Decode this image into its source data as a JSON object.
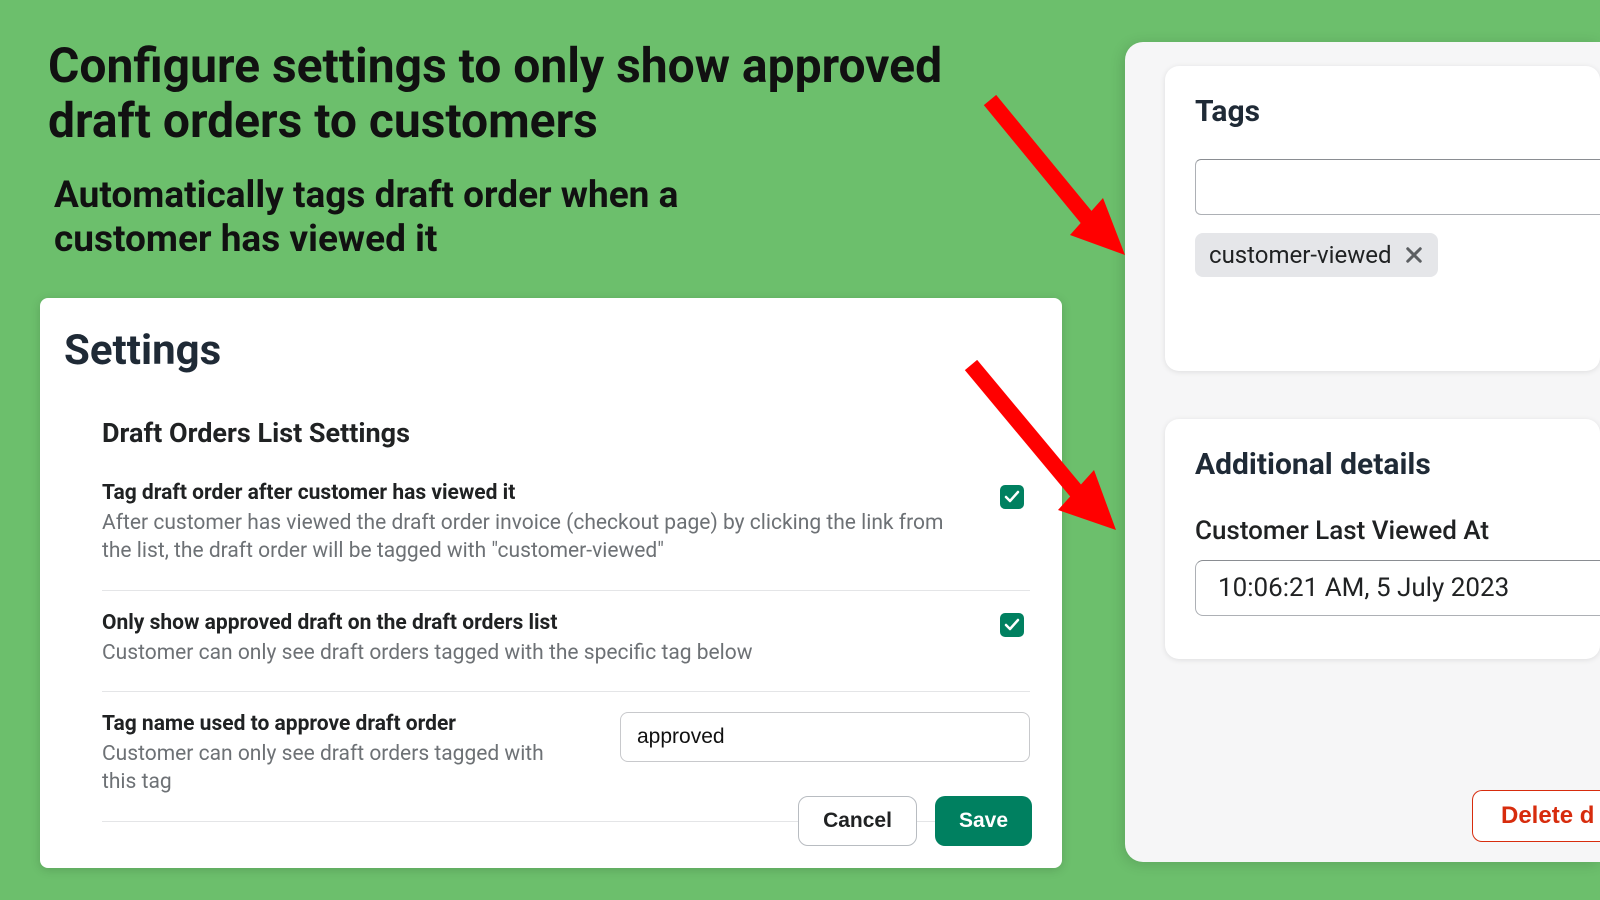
{
  "hero": {
    "title": "Configure settings to only show approved draft orders to customers",
    "subtitle": "Automatically tags draft order when a customer has viewed it"
  },
  "settings": {
    "title": "Settings",
    "section_title": "Draft Orders List Settings",
    "rows": {
      "tag_viewed": {
        "label": "Tag draft order after customer has viewed it",
        "desc": "After customer has viewed the draft order invoice (checkout page) by clicking the link from the list, the draft order will be tagged with \"customer-viewed\"",
        "checked": true
      },
      "only_approved": {
        "label": "Only show approved draft on the draft orders list",
        "desc": "Customer can only see draft orders tagged with the specific tag below",
        "checked": true
      },
      "tag_name": {
        "label": "Tag name used to approve draft order",
        "desc": "Customer can only see draft orders tagged with this tag",
        "value": "approved"
      }
    },
    "buttons": {
      "cancel": "Cancel",
      "save": "Save"
    }
  },
  "side": {
    "tags": {
      "title": "Tags",
      "chip": "customer-viewed"
    },
    "details": {
      "title": "Additional details",
      "label": "Customer Last Viewed At",
      "value": "10:06:21 AM, 5 July 2023"
    },
    "delete_label": "Delete d"
  }
}
